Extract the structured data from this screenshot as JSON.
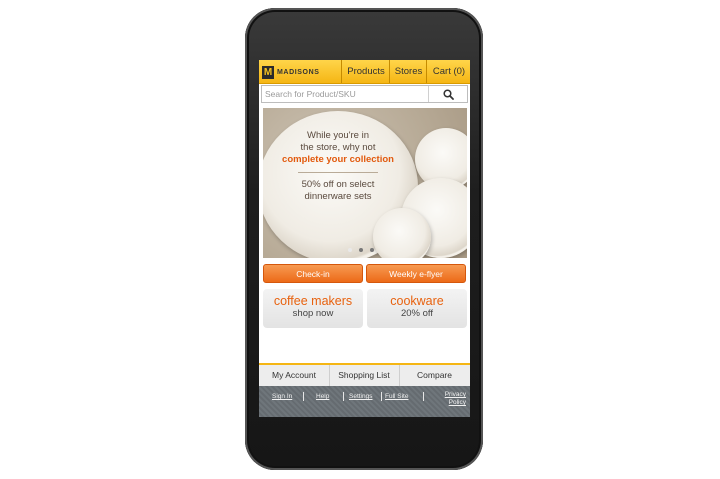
{
  "brand": {
    "name": "MADISONS",
    "mark": "M"
  },
  "nav": {
    "products": "Products",
    "stores": "Stores",
    "cart": "Cart (0)"
  },
  "search": {
    "placeholder": "Search for Product/SKU"
  },
  "banner": {
    "line1": "While you're in",
    "line2": "the store, why not",
    "highlight": "complete your collection",
    "offer1": "50% off on select",
    "offer2": "dinnerware sets",
    "slides": 3,
    "active_slide": 1
  },
  "buttons": {
    "checkin": "Check-in",
    "flyer": "Weekly e-flyer"
  },
  "promos": [
    {
      "title": "coffee makers",
      "sub": "shop now"
    },
    {
      "title": "cookware",
      "sub": "20% off"
    }
  ],
  "footer_tabs": {
    "account": "My Account",
    "list": "Shopping List",
    "compare": "Compare"
  },
  "footer_links": {
    "signin": "Sign In",
    "help": "Help",
    "settings": "Settings",
    "fullsite": "Full Site",
    "privacy1": "Privacy",
    "privacy2": "Policy"
  },
  "colors": {
    "accent": "#f5b614",
    "orange": "#ec6a18",
    "promo_text": "#e8620f"
  },
  "icons": {
    "search": "search-icon"
  }
}
